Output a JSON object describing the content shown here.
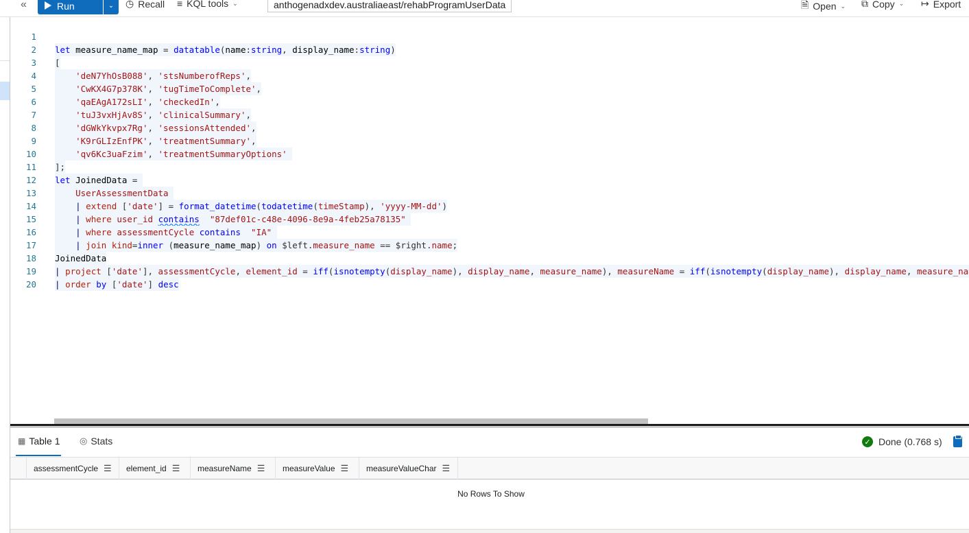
{
  "toolbar": {
    "collapse_glyph": "«",
    "run_label": "Run",
    "recall_label": "Recall",
    "kql_tools_label": "KQL tools",
    "cluster_path": "anthogenadxdev.australiaeast/rehabProgramUserData",
    "open_label": "Open",
    "copy_label": "Copy",
    "export_label": "Export"
  },
  "editor": {
    "line_numbers": [
      "1",
      "2",
      "3",
      "4",
      "5",
      "6",
      "7",
      "8",
      "9",
      "10",
      "11",
      "12",
      "13",
      "14",
      "15",
      "16",
      "17",
      "18",
      "19",
      "20"
    ]
  },
  "results": {
    "tabs": [
      {
        "label": "Table 1",
        "icon": "table-icon"
      },
      {
        "label": "Stats",
        "icon": "stats-icon"
      }
    ],
    "status_text": "Done (0.768 s)",
    "columns": [
      "assessmentCycle",
      "element_id",
      "measureName",
      "measureValue",
      "measureValueChar"
    ],
    "empty_message": "No Rows To Show"
  },
  "colors": {
    "accent": "#0f6cbd",
    "success": "#107c10",
    "keyword": "#0000ff",
    "string": "#a31515",
    "line_number": "#237893"
  }
}
